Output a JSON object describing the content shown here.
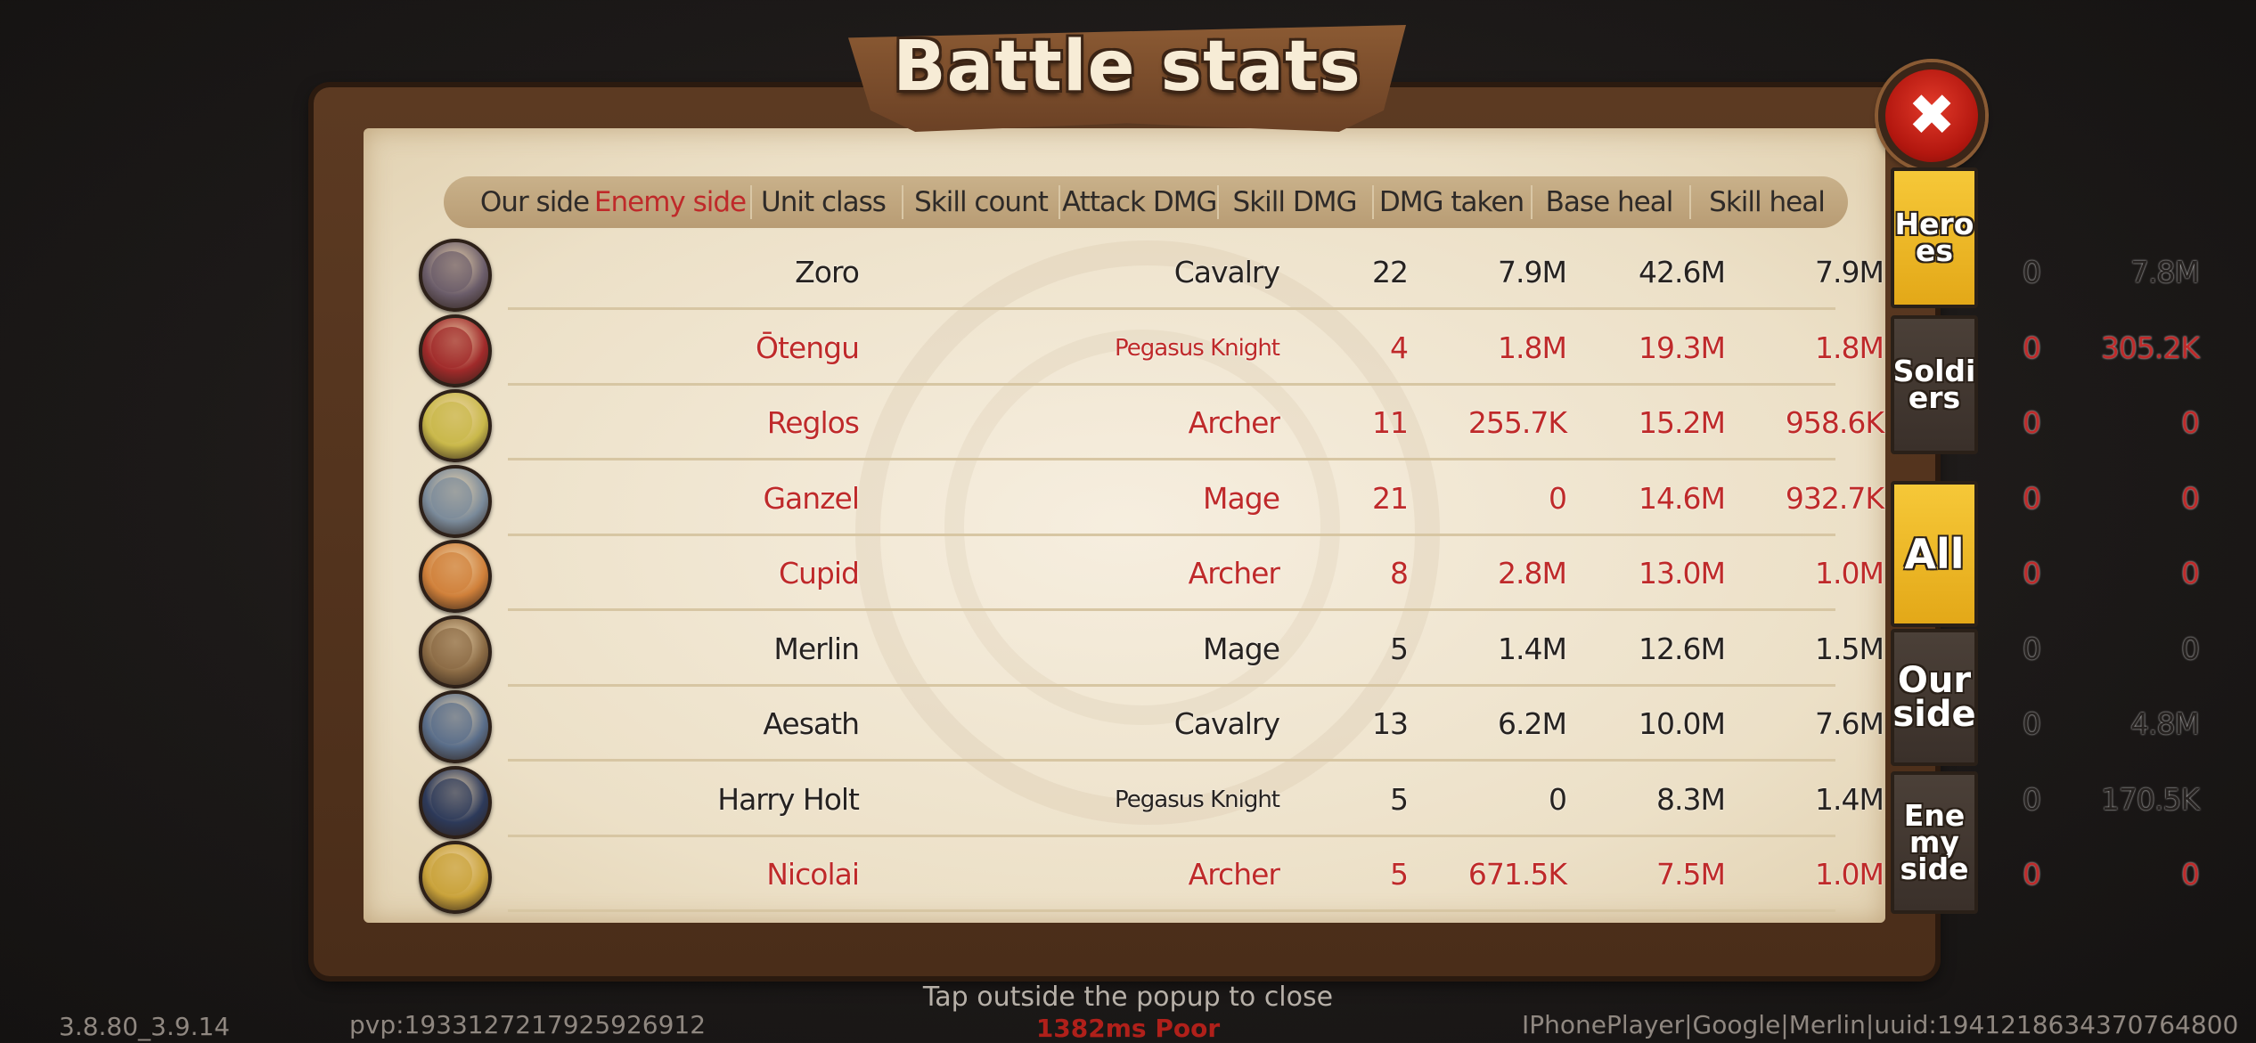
{
  "title": "Battle stats",
  "close_symbol": "✖",
  "colors": {
    "our_side_text": "#262220",
    "enemy_side_text": "#bf2a2a",
    "tab_active": "#f2bd2c",
    "tab_inactive": "#3f3530"
  },
  "header": {
    "our_side": "Our side",
    "enemy_side": "Enemy side",
    "columns": [
      "Unit class",
      "Skill count",
      "Attack DMG",
      "Skill DMG",
      "DMG taken",
      "Base heal",
      "Skill heal"
    ]
  },
  "rows": [
    {
      "name": "Zoro",
      "unit_class": "Cavalry",
      "skill_count": "22",
      "attack_dmg": "7.9M",
      "skill_dmg": "42.6M",
      "dmg_taken": "7.9M",
      "base_heal": "0",
      "skill_heal": "7.8M",
      "side": "our",
      "avatar_icon": "dark-knight-portrait"
    },
    {
      "name": "Ōtengu",
      "unit_class": "Pegasus Knight",
      "skill_count": "4",
      "attack_dmg": "1.8M",
      "skill_dmg": "19.3M",
      "dmg_taken": "1.8M",
      "base_heal": "0",
      "skill_heal": "305.2K",
      "side": "enemy",
      "avatar_icon": "tengu-portrait"
    },
    {
      "name": "Reglos",
      "unit_class": "Archer",
      "skill_count": "11",
      "attack_dmg": "255.7K",
      "skill_dmg": "15.2M",
      "dmg_taken": "958.6K",
      "base_heal": "0",
      "skill_heal": "0",
      "side": "enemy",
      "avatar_icon": "elf-archer-portrait"
    },
    {
      "name": "Ganzel",
      "unit_class": "Mage",
      "skill_count": "21",
      "attack_dmg": "0",
      "skill_dmg": "14.6M",
      "dmg_taken": "932.7K",
      "base_heal": "0",
      "skill_heal": "0",
      "side": "enemy",
      "avatar_icon": "wizard-portrait"
    },
    {
      "name": "Cupid",
      "unit_class": "Archer",
      "skill_count": "8",
      "attack_dmg": "2.8M",
      "skill_dmg": "13.0M",
      "dmg_taken": "1.0M",
      "base_heal": "0",
      "skill_heal": "0",
      "side": "enemy",
      "avatar_icon": "cupid-portrait"
    },
    {
      "name": "Merlin",
      "unit_class": "Mage",
      "skill_count": "5",
      "attack_dmg": "1.4M",
      "skill_dmg": "12.6M",
      "dmg_taken": "1.5M",
      "base_heal": "0",
      "skill_heal": "0",
      "side": "our",
      "avatar_icon": "hooded-mage-portrait"
    },
    {
      "name": "Aesath",
      "unit_class": "Cavalry",
      "skill_count": "13",
      "attack_dmg": "6.2M",
      "skill_dmg": "10.0M",
      "dmg_taken": "7.6M",
      "base_heal": "0",
      "skill_heal": "4.8M",
      "side": "our",
      "avatar_icon": "armored-knight-portrait"
    },
    {
      "name": "Harry Holt",
      "unit_class": "Pegasus Knight",
      "skill_count": "5",
      "attack_dmg": "0",
      "skill_dmg": "8.3M",
      "dmg_taken": "1.4M",
      "base_heal": "0",
      "skill_heal": "170.5K",
      "side": "our",
      "avatar_icon": "young-wizard-portrait"
    },
    {
      "name": "Nicolai",
      "unit_class": "Archer",
      "skill_count": "5",
      "attack_dmg": "671.5K",
      "skill_dmg": "7.5M",
      "dmg_taken": "1.0M",
      "base_heal": "0",
      "skill_heal": "0",
      "side": "enemy",
      "avatar_icon": "golden-warrior-portrait"
    }
  ],
  "side_tabs": {
    "heroes": "Hero\nes",
    "soldiers": "Soldi\ners",
    "all": "All",
    "our_side": "Our\nside",
    "enemy_side": "Ene\nmy\nside"
  },
  "footer": {
    "close_hint": "Tap outside the popup to close",
    "ping": "1382ms Poor",
    "version": "3.8.80_3.9.14",
    "pvp": "pvp:1933127217925926912",
    "account": "IPhonePlayer|Google|Merlin|uuid:1941218634370764800"
  }
}
